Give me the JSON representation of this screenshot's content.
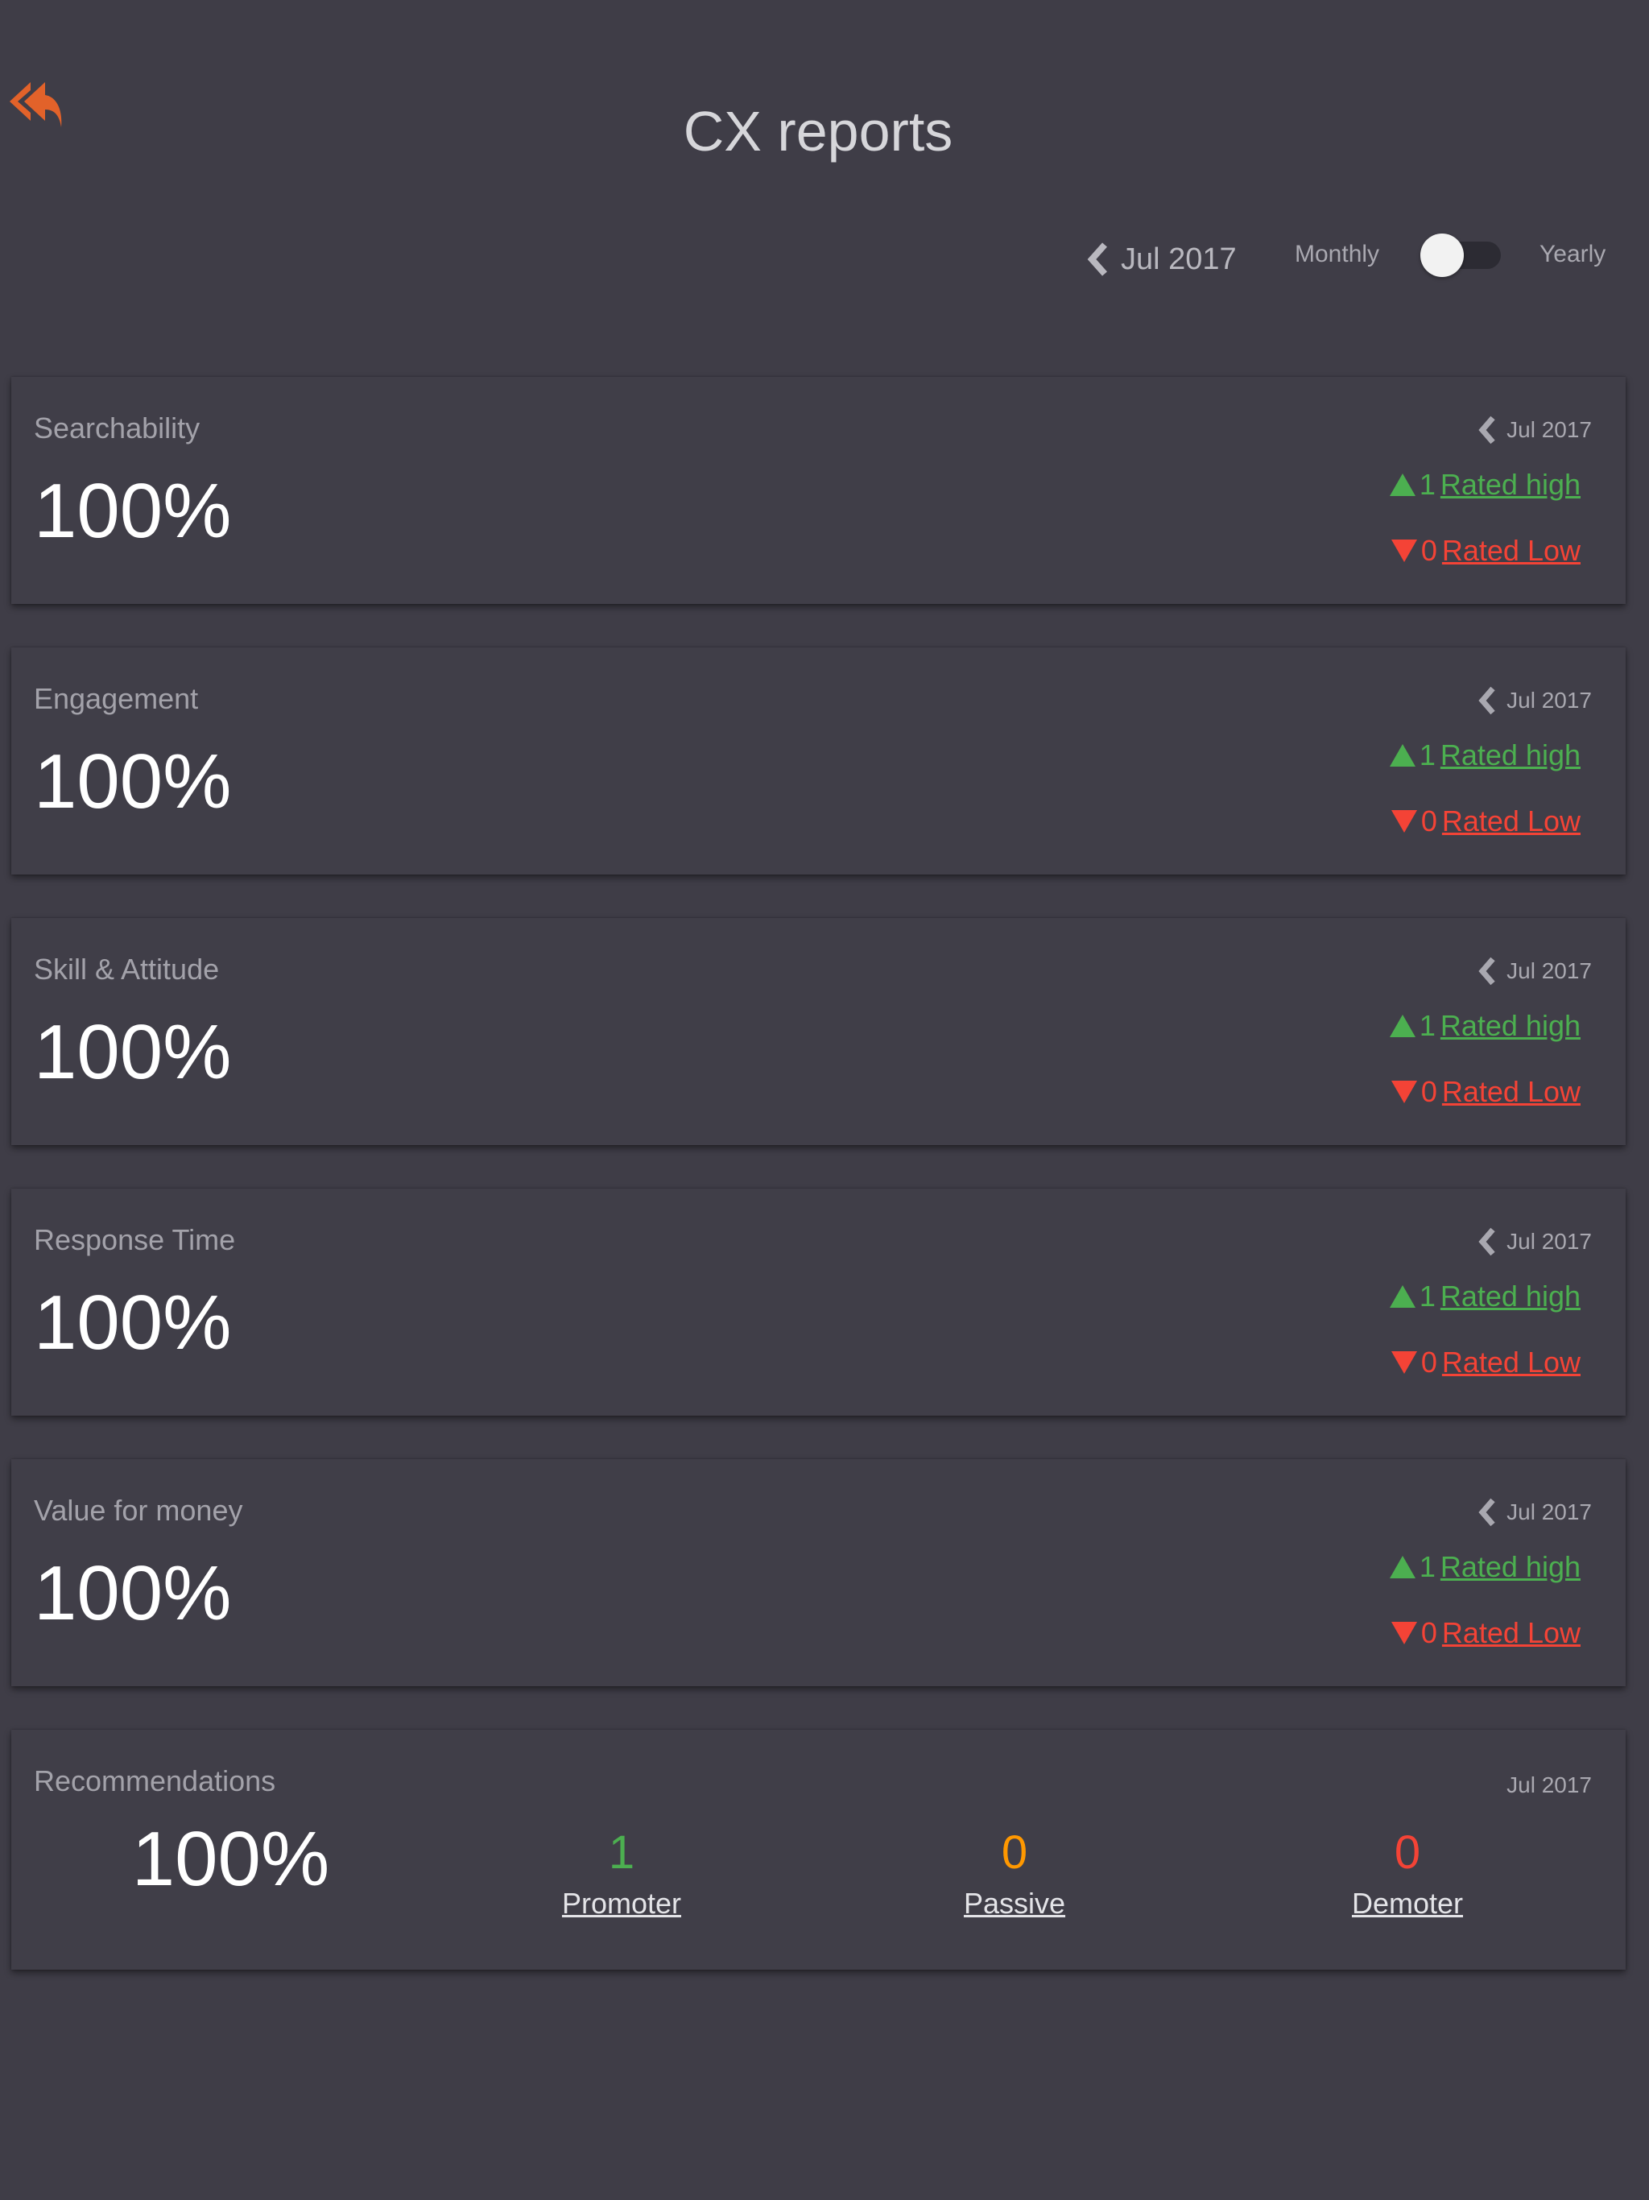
{
  "header": {
    "title": "CX reports",
    "back_icon": "reply-all-icon",
    "back_color": "#e2622a"
  },
  "controls": {
    "period_label": "Jul 2017",
    "toggle_left": "Monthly",
    "toggle_right": "Yearly",
    "toggle_state": "monthly"
  },
  "colors": {
    "high": "#4caf50",
    "low": "#f44336",
    "passive": "#ff9800"
  },
  "cards": [
    {
      "title": "Searchability",
      "value": "100%",
      "period": "Jul 2017",
      "high_count": "1",
      "high_label": "Rated high",
      "low_count": "0",
      "low_label": "Rated Low"
    },
    {
      "title": "Engagement",
      "value": "100%",
      "period": "Jul 2017",
      "high_count": "1",
      "high_label": "Rated high",
      "low_count": "0",
      "low_label": "Rated Low"
    },
    {
      "title": "Skill & Attitude",
      "value": "100%",
      "period": "Jul 2017",
      "high_count": "1",
      "high_label": "Rated high",
      "low_count": "0",
      "low_label": "Rated Low"
    },
    {
      "title": "Response Time",
      "value": "100%",
      "period": "Jul 2017",
      "high_count": "1",
      "high_label": "Rated high",
      "low_count": "0",
      "low_label": "Rated Low"
    },
    {
      "title": "Value for money",
      "value": "100%",
      "period": "Jul 2017",
      "high_count": "1",
      "high_label": "Rated high",
      "low_count": "0",
      "low_label": "Rated Low"
    }
  ],
  "recommendations": {
    "title": "Recommendations",
    "period": "Jul 2017",
    "value": "100%",
    "promoter": {
      "count": "1",
      "label": "Promoter"
    },
    "passive": {
      "count": "0",
      "label": "Passive"
    },
    "demoter": {
      "count": "0",
      "label": "Demoter"
    }
  }
}
